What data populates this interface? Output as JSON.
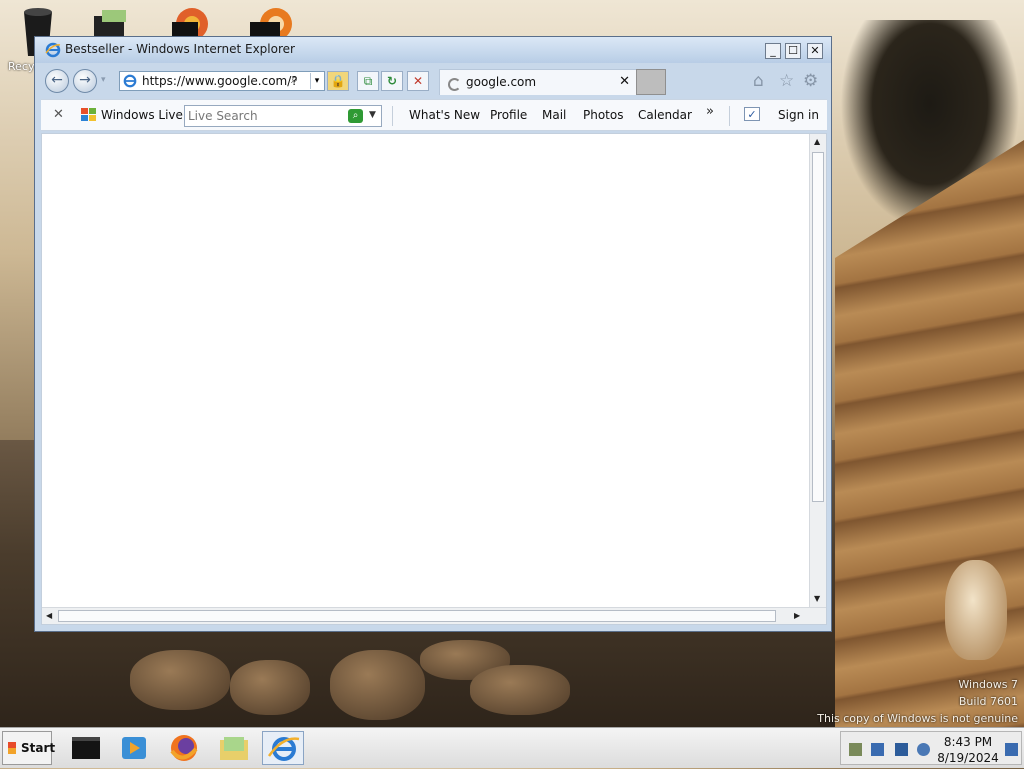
{
  "desktop": {
    "icons": [
      {
        "name": "recycle-bin-icon",
        "label": "Recy"
      }
    ],
    "watermark": {
      "line1": "Windows 7",
      "line2": "Build 7601",
      "line3": "This copy of Windows is not genuine"
    }
  },
  "window": {
    "title": "Bestseller - Windows Internet Explorer",
    "minimize_label": "_",
    "maximize_label": "☐",
    "close_label": "✕"
  },
  "navbar": {
    "back_label": "←",
    "forward_label": "→",
    "address": "https://www.google.com/?",
    "search_glyph": "⌕",
    "dropdown_glyph": "▾",
    "lock_glyph": "🔒",
    "compat_glyph": "⧉",
    "refresh_glyph": "↻",
    "stop_glyph": "✕",
    "tab_label": "google.com",
    "tab_close": "✕",
    "home_glyph": "⌂",
    "favorites_glyph": "☆",
    "tools_glyph": "⚙"
  },
  "commandbar": {
    "close_glyph": "✕",
    "brand": "Windows Live",
    "search_placeholder": "Live Search",
    "search_go_glyph": "⌕",
    "search_dd_glyph": "▼",
    "links": [
      "What's New",
      "Profile",
      "Mail",
      "Photos",
      "Calendar"
    ],
    "more_glyph": "»",
    "check_glyph": "✓",
    "sign_in": "Sign in"
  },
  "scroll": {
    "up": "▲",
    "down": "▼",
    "left": "◀",
    "right": "▶"
  },
  "taskbar": {
    "start_label": "Start",
    "apps": [
      "terminal-app",
      "media-player-app",
      "firefox-app",
      "file-explorer-app",
      "internet-explorer-app"
    ],
    "clock_time": "8:43 PM",
    "clock_date": "8/19/2024"
  }
}
